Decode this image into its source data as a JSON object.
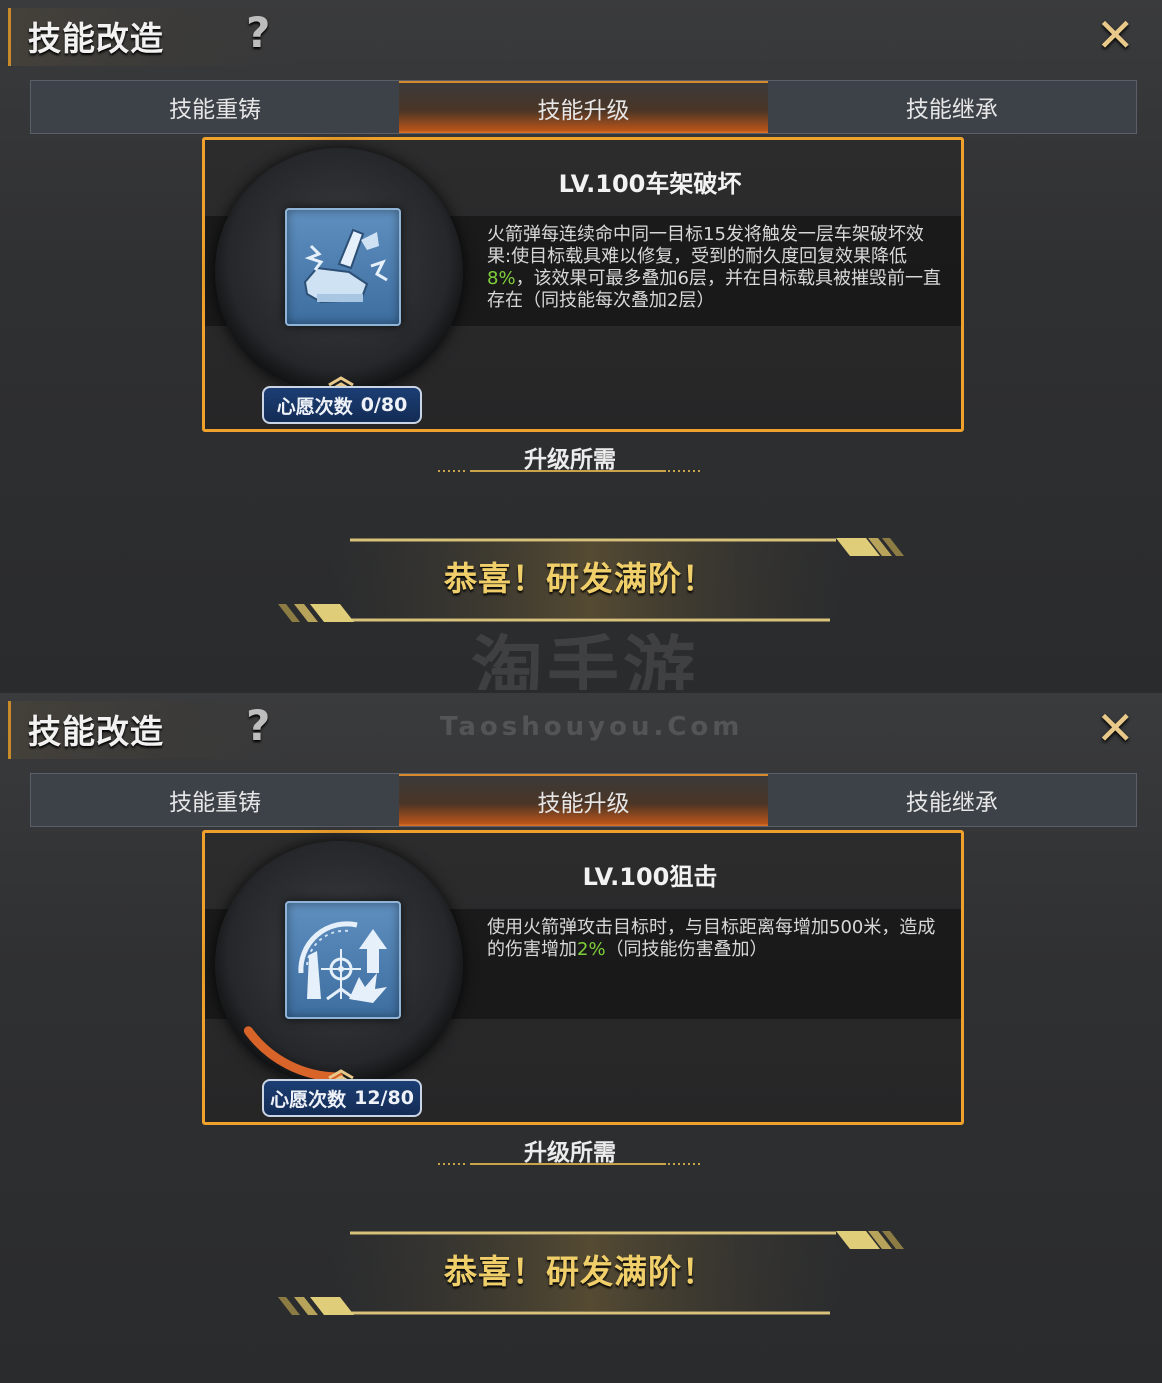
{
  "panels": [
    {
      "title": "技能改造",
      "help_icon": "?",
      "close_icon": "✕",
      "tabs": [
        "技能重铸",
        "技能升级",
        "技能继承"
      ],
      "active_tab": 1,
      "skill": {
        "name": "LV.100车架破坏",
        "icon": "frame-destruction-icon",
        "desc_before": "火箭弹每连续命中同一目标15发将触发一层车架破坏效果:使目标载具难以修复，受到的耐久度回复效果降低",
        "desc_highlight": "8%",
        "desc_after": "，该效果可最多叠加6层，并在目标载具被摧毁前一直存在（同技能每次叠加2层）",
        "wish_label": "心愿次数",
        "wish_count": "0/80",
        "wish_progress": 0.0
      },
      "requirement_title": "升级所需",
      "congrats": "恭喜！研发满阶！"
    },
    {
      "title": "技能改造",
      "help_icon": "?",
      "close_icon": "✕",
      "tabs": [
        "技能重铸",
        "技能升级",
        "技能继承"
      ],
      "active_tab": 1,
      "skill": {
        "name": "LV.100狙击",
        "icon": "sniper-icon",
        "desc_before": "使用火箭弹攻击目标时，与目标距离每增加500米，造成的伤害增加",
        "desc_highlight": "2%",
        "desc_after": "（同技能伤害叠加）",
        "wish_label": "心愿次数",
        "wish_count": "12/80",
        "wish_progress": 0.15
      },
      "requirement_title": "升级所需",
      "congrats": "恭喜！研发满阶！"
    }
  ],
  "watermark": {
    "cn": "淘手游",
    "en": "Taoshouyou.Com"
  },
  "colors": {
    "accent_orange": "#f0a12b",
    "highlight_green": "#7fcf3a",
    "gold_text": "#f0cf6a",
    "badge_blue": "#1c3e74"
  }
}
